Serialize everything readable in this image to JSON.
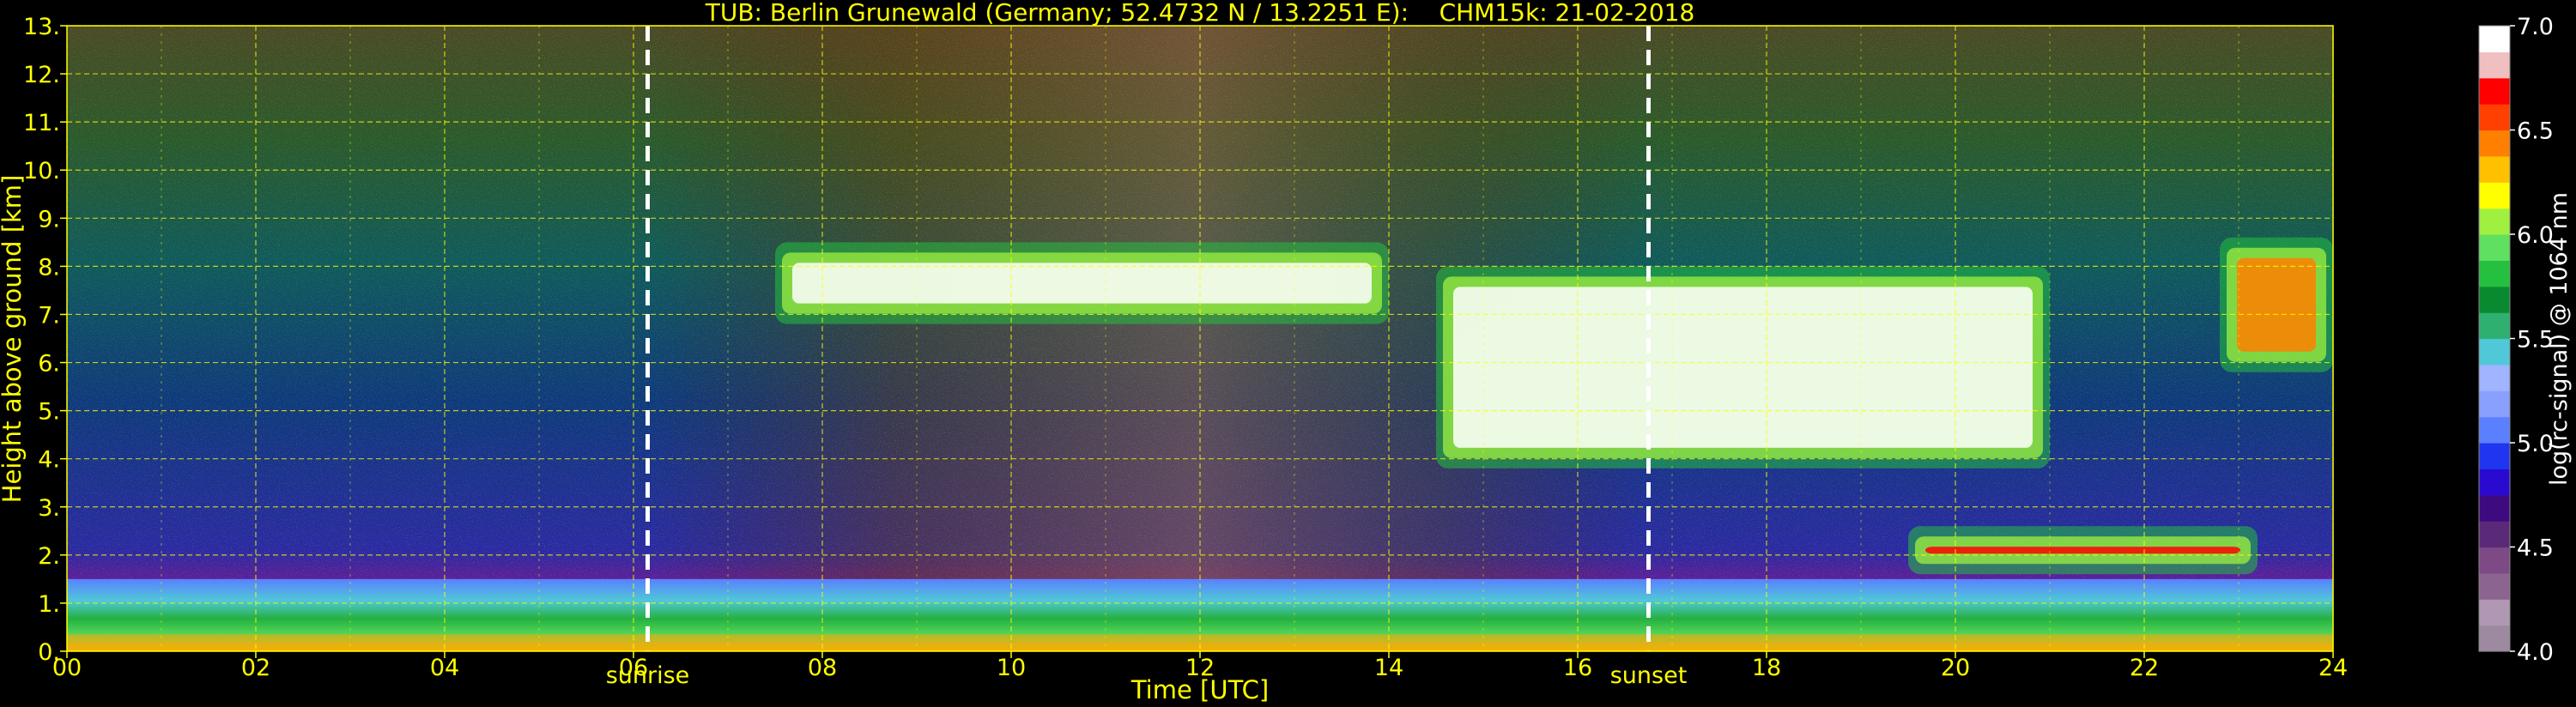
{
  "chart_data": {
    "type": "heatmap",
    "title": "TUB: Berlin Grunewald (Germany; 52.4732 N / 13.2251 E):    CHM15k: 21-02-2018",
    "xlabel": "Time [UTC]",
    "ylabel": "Height above ground [km]",
    "x_range": [
      0,
      24
    ],
    "y_range": [
      0,
      13
    ],
    "x_ticks": [
      "00",
      "02",
      "04",
      "06",
      "08",
      "10",
      "12",
      "14",
      "16",
      "18",
      "20",
      "22",
      "24"
    ],
    "y_ticks": [
      "0.",
      "1.",
      "2.",
      "3.",
      "4.",
      "5.",
      "6.",
      "7.",
      "8.",
      "9.",
      "10.",
      "11.",
      "12.",
      "13."
    ],
    "grid": true,
    "grid_color": "#ffff00",
    "colorbar": {
      "label": "log(rc-signal) @ 1064 nm",
      "range": [
        4.0,
        7.0
      ],
      "ticks": [
        "4.0",
        "4.5",
        "5.0",
        "5.5",
        "6.0",
        "6.5",
        "7.0"
      ],
      "colors": [
        "#9e8aa0",
        "#b097b3",
        "#8c6490",
        "#7d4a86",
        "#5a2a78",
        "#3d0a80",
        "#2a0ad0",
        "#1f35f0",
        "#5a80ff",
        "#8aa0ff",
        "#a0b4ff",
        "#50c8d8",
        "#30b070",
        "#0a8a30",
        "#25c040",
        "#60e060",
        "#a0f040",
        "#ffff00",
        "#ffc000",
        "#ff8000",
        "#ff4000",
        "#ff0000",
        "#f0c0c0",
        "#ffffff"
      ]
    },
    "markers": [
      {
        "label": "sunrise",
        "x": 6.15
      },
      {
        "label": "sunset",
        "x": 16.75
      }
    ],
    "features": [
      {
        "name": "boundary layer aerosol",
        "x": [
          0,
          24
        ],
        "y": [
          0,
          1.5
        ],
        "level": 5.5
      },
      {
        "name": "cirrus cloud morning",
        "x": [
          7.5,
          14
        ],
        "y": [
          6.8,
          8.5
        ],
        "level": 7.0
      },
      {
        "name": "cirrus cloud afternoon",
        "x": [
          14.5,
          21
        ],
        "y": [
          3.8,
          8.0
        ],
        "level": 7.0
      },
      {
        "name": "cloud layer evening",
        "x": [
          19.5,
          23.2
        ],
        "y": [
          1.6,
          2.6
        ],
        "level": 6.8
      },
      {
        "name": "cirrus late",
        "x": [
          22.8,
          24
        ],
        "y": [
          5.8,
          8.6
        ],
        "level": 6.5
      }
    ]
  }
}
